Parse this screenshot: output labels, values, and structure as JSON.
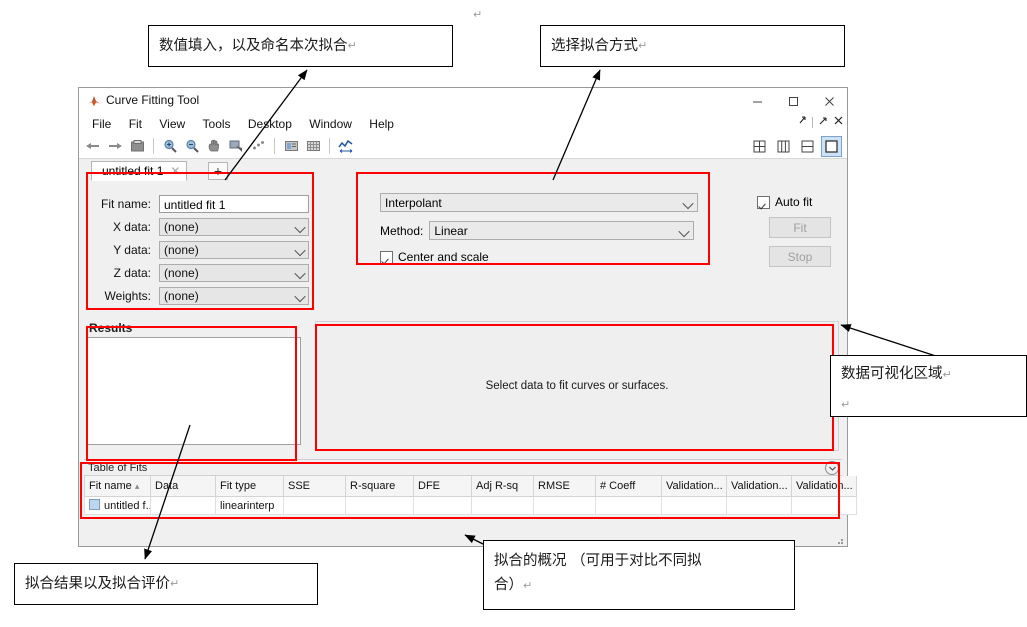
{
  "window": {
    "title": "Curve Fitting Tool",
    "controls": {
      "minimize": "minimize-button",
      "maximize": "maximize-button",
      "close": "close-button"
    }
  },
  "menu": {
    "items": [
      "File",
      "Fit",
      "View",
      "Tools",
      "Desktop",
      "Window",
      "Help"
    ]
  },
  "toolbar": {
    "icons": [
      "pan-left-icon",
      "pan-right-icon",
      "print-icon",
      "zoom-in-icon",
      "zoom-out-icon",
      "hand-pan-icon",
      "data-cursor-icon",
      "exclude-outliers-icon",
      "legend-icon",
      "grid-icon",
      "axes-limits-icon"
    ],
    "layout_buttons": [
      "layout-grid-2x2",
      "layout-columns",
      "layout-rows",
      "layout-single"
    ],
    "layout_selected": "layout-single"
  },
  "tabs": {
    "active": "untitled fit 1",
    "close_glyph": "✕",
    "add_glyph": "+"
  },
  "fit_definition": {
    "fit_name_label": "Fit name:",
    "fit_name_value": "untitled fit 1",
    "x_data_label": "X data:",
    "x_data_value": "(none)",
    "y_data_label": "Y data:",
    "y_data_value": "(none)",
    "z_data_label": "Z data:",
    "z_data_value": "(none)",
    "weights_label": "Weights:",
    "weights_value": "(none)"
  },
  "fit_type": {
    "type_value": "Interpolant",
    "method_label": "Method:",
    "method_value": "Linear",
    "center_and_scale_label": "Center and scale",
    "center_and_scale_checked": true
  },
  "fit_controls": {
    "auto_fit_label": "Auto fit",
    "auto_fit_checked": true,
    "fit_button": "Fit",
    "stop_button": "Stop"
  },
  "results": {
    "title": "Results",
    "content": ""
  },
  "plot": {
    "message": "Select data to fit curves or surfaces."
  },
  "table_of_fits": {
    "title": "Table of Fits",
    "sort_indicator": "▴",
    "columns": [
      "Fit name",
      "Data",
      "Fit type",
      "SSE",
      "R-square",
      "DFE",
      "Adj R-sq",
      "RMSE",
      "# Coeff",
      "Validation...",
      "Validation...",
      "Validation..."
    ],
    "rows": [
      {
        "fit_name": "untitled f...",
        "data": "",
        "fit_type": "linearinterp",
        "sse": "",
        "r_square": "",
        "dfe": "",
        "adj_r_sq": "",
        "rmse": "",
        "n_coeff": "",
        "validation_1": "",
        "validation_2": "",
        "validation_3": ""
      }
    ]
  },
  "annotations": {
    "top_left": "数值填入，以及命名本次拟合",
    "top_right": "选择拟合方式",
    "right": "数据可视化区域",
    "right_line2": "",
    "bottom_left": "拟合结果以及拟合评价",
    "bottom_right_line1": "拟合的概况 （可用于对比不同拟",
    "bottom_right_line2": "合）",
    "pilcrow": "↵"
  },
  "colors": {
    "annotation_border": "#000000",
    "highlight_box": "#ff0000",
    "window_bg": "#f0f0f0",
    "selected_layout": "#cce3f7"
  }
}
